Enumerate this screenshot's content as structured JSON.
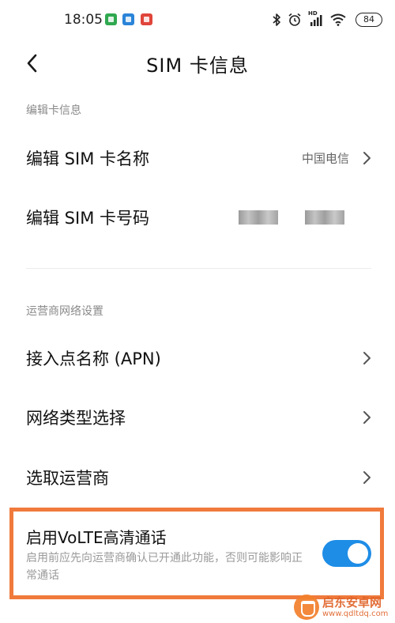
{
  "status_bar": {
    "time": "18:05",
    "battery": "84",
    "hd_label": "HD",
    "icons": [
      "notification-green-icon",
      "notification-blue-icon",
      "notification-red-icon",
      "bluetooth-icon",
      "alarm-icon",
      "signal-icon",
      "wifi-icon",
      "battery-icon"
    ]
  },
  "header": {
    "title": "SIM 卡信息",
    "back_icon": "back-arrow-icon"
  },
  "sections": {
    "edit_card_info": {
      "label": "编辑卡信息",
      "items": [
        {
          "label": "编辑 SIM 卡名称",
          "value": "中国电信"
        },
        {
          "label": "编辑 SIM 卡号码"
        }
      ]
    },
    "carrier_network": {
      "label": "运营商网络设置",
      "items": [
        {
          "label": "接入点名称 (APN)"
        },
        {
          "label": "网络类型选择"
        },
        {
          "label": "选取运营商"
        }
      ]
    }
  },
  "volte": {
    "title": "启用VoLTE高清通话",
    "description": "启用前应先向运营商确认已开通此功能，否则可能影响正常通话",
    "enabled": true
  },
  "watermark": {
    "title": "启东安卓网",
    "url": "www.qdltdq.com"
  },
  "colors": {
    "accent": "#1e8de6",
    "highlight": "#f07a3c",
    "section_label": "#8a8a8a"
  }
}
